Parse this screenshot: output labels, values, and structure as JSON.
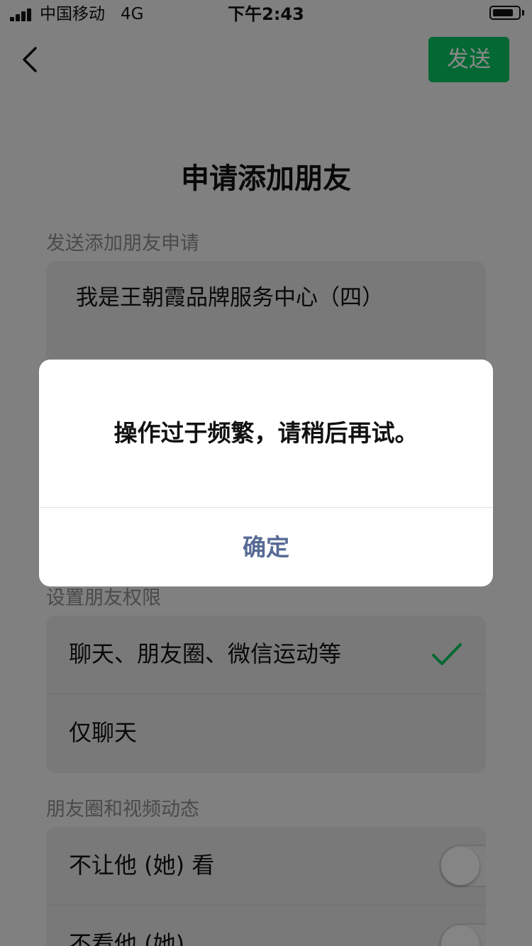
{
  "status_bar": {
    "carrier": "中国移动",
    "network": "4G",
    "time": "下午2:43"
  },
  "nav": {
    "send_label": "发送"
  },
  "page": {
    "title": "申请添加朋友"
  },
  "request_section": {
    "label": "发送添加朋友申请",
    "message": "我是王朝霞品牌服务中心（四）"
  },
  "permission_section": {
    "label": "设置朋友权限",
    "options": [
      {
        "label": "聊天、朋友圈、微信运动等",
        "selected": true
      },
      {
        "label": "仅聊天",
        "selected": false
      }
    ]
  },
  "moments_section": {
    "label": "朋友圈和视频动态",
    "toggles": [
      {
        "label": "不让他 (她) 看",
        "on": false
      },
      {
        "label": "不看他 (她)",
        "on": false
      }
    ]
  },
  "dialog": {
    "message": "操作过于频繁，请稍后再试。",
    "confirm_label": "确定"
  },
  "colors": {
    "accent_green": "#07c160",
    "dialog_link_blue": "#576b95",
    "overlay": "rgba(0,0,0,0.46)"
  }
}
